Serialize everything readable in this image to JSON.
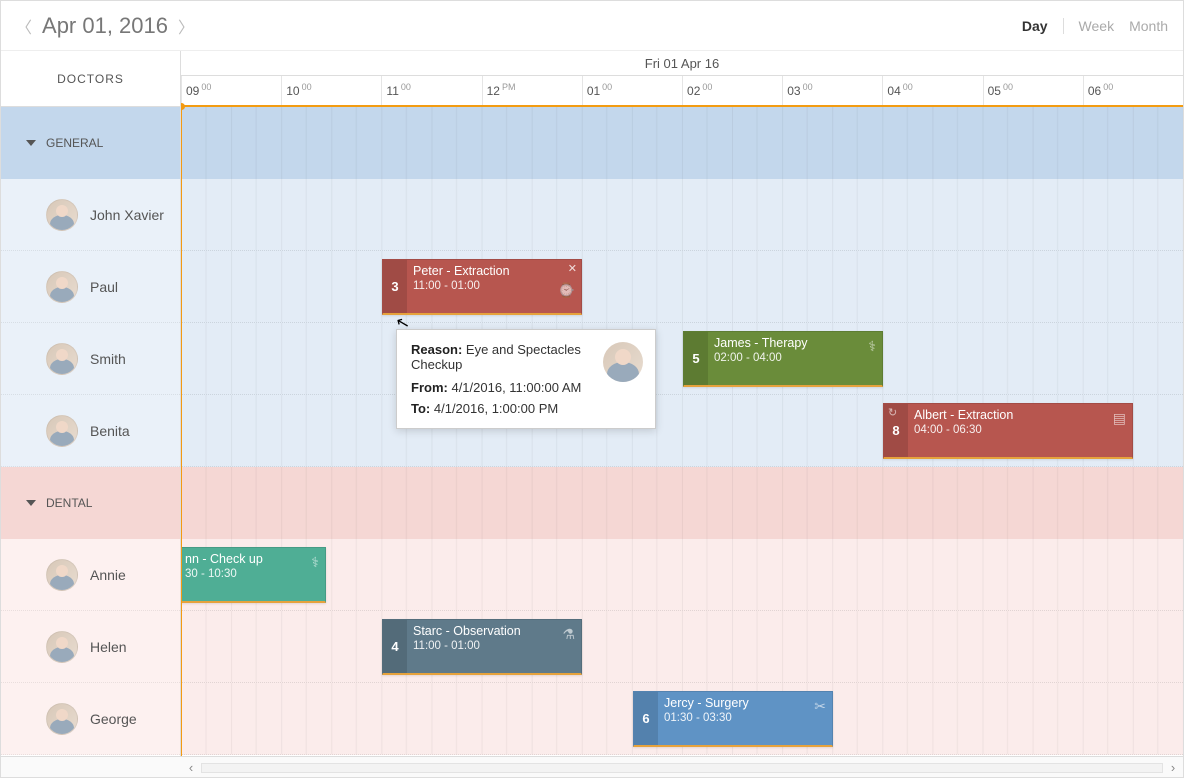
{
  "header": {
    "date": "Apr 01, 2016",
    "views": {
      "day": "Day",
      "week": "Week",
      "month": "Month"
    }
  },
  "sidebar": {
    "title": "DOCTORS",
    "groups": [
      {
        "name": "GENERAL",
        "resources": [
          "John Xavier",
          "Paul",
          "Smith",
          "Benita"
        ]
      },
      {
        "name": "DENTAL",
        "resources": [
          "Annie",
          "Helen",
          "George"
        ]
      }
    ]
  },
  "timeline": {
    "dayHeader": "Fri 01 Apr 16",
    "hours": [
      {
        "h": "09",
        "m": "00"
      },
      {
        "h": "10",
        "m": "00"
      },
      {
        "h": "11",
        "m": "00"
      },
      {
        "h": "12",
        "m": "PM"
      },
      {
        "h": "01",
        "m": "00"
      },
      {
        "h": "02",
        "m": "00"
      },
      {
        "h": "03",
        "m": "00"
      },
      {
        "h": "04",
        "m": "00"
      },
      {
        "h": "05",
        "m": "00"
      },
      {
        "h": "06",
        "m": "00"
      }
    ]
  },
  "appointments": {
    "a1": {
      "badge": "3",
      "title": "Peter - Extraction",
      "time": "11:00 - 01:00"
    },
    "a2": {
      "badge": "5",
      "title": "James - Therapy",
      "time": "02:00 - 04:00"
    },
    "a3": {
      "badge": "8",
      "title": "Albert - Extraction",
      "time": "04:00 - 06:30"
    },
    "a4": {
      "title": "nn - Check up",
      "time": "30 - 10:30"
    },
    "a5": {
      "badge": "4",
      "title": "Starc - Observation",
      "time": "11:00 - 01:00"
    },
    "a6": {
      "badge": "6",
      "title": "Jercy - Surgery",
      "time": "01:30 - 03:30"
    }
  },
  "tooltip": {
    "reasonLabel": "Reason:",
    "reason": "Eye and Spectacles Checkup",
    "fromLabel": "From:",
    "from": "4/1/2016, 11:00:00 AM",
    "toLabel": "To:",
    "to": "4/1/2016, 1:00:00 PM"
  }
}
